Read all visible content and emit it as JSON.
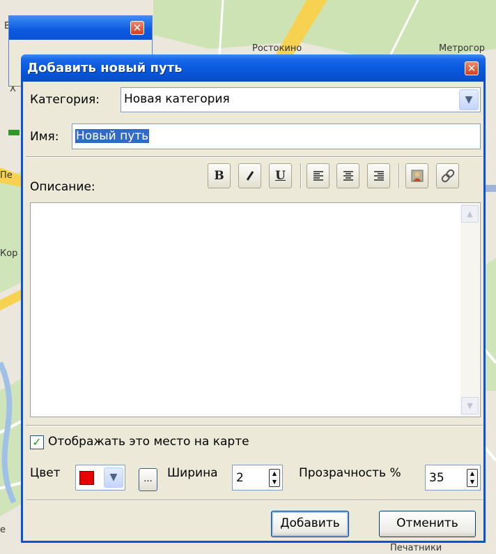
{
  "map": {
    "labels": [
      "Ви",
      "Ростокино",
      "Метрогор",
      "Х",
      "Пе",
      "Кор",
      "е",
      "Печатники"
    ]
  },
  "back_window": {
    "close_icon": "close-icon"
  },
  "dialog": {
    "title": "Добавить новый путь",
    "close_glyph": "✕",
    "category_label": "Категория:",
    "category_value": "Новая категория",
    "name_label": "Имя:",
    "name_value": "Новый путь",
    "description_label": "Описание:",
    "toolbar": {
      "bold": "B",
      "italic": "I",
      "underline": "U",
      "icons": [
        "bold-icon",
        "italic-icon",
        "underline-icon",
        "align-left-icon",
        "align-center-icon",
        "align-right-icon",
        "insert-image-icon",
        "insert-link-icon"
      ]
    },
    "description_value": "",
    "show_on_map_label": "Отображать это место на карте",
    "show_on_map_checked": true,
    "color_label": "Цвет",
    "color_value": "#e60000",
    "more_label": "...",
    "width_label": "Ширина",
    "width_value": "2",
    "opacity_label": "Прозрачность %",
    "opacity_value": "35",
    "add_button": "Добавить",
    "cancel_button": "Отменить"
  },
  "colors": {
    "titlebar": "#0a5ae0",
    "dialog_bg": "#ece9d8",
    "selection": "#316ac5"
  }
}
